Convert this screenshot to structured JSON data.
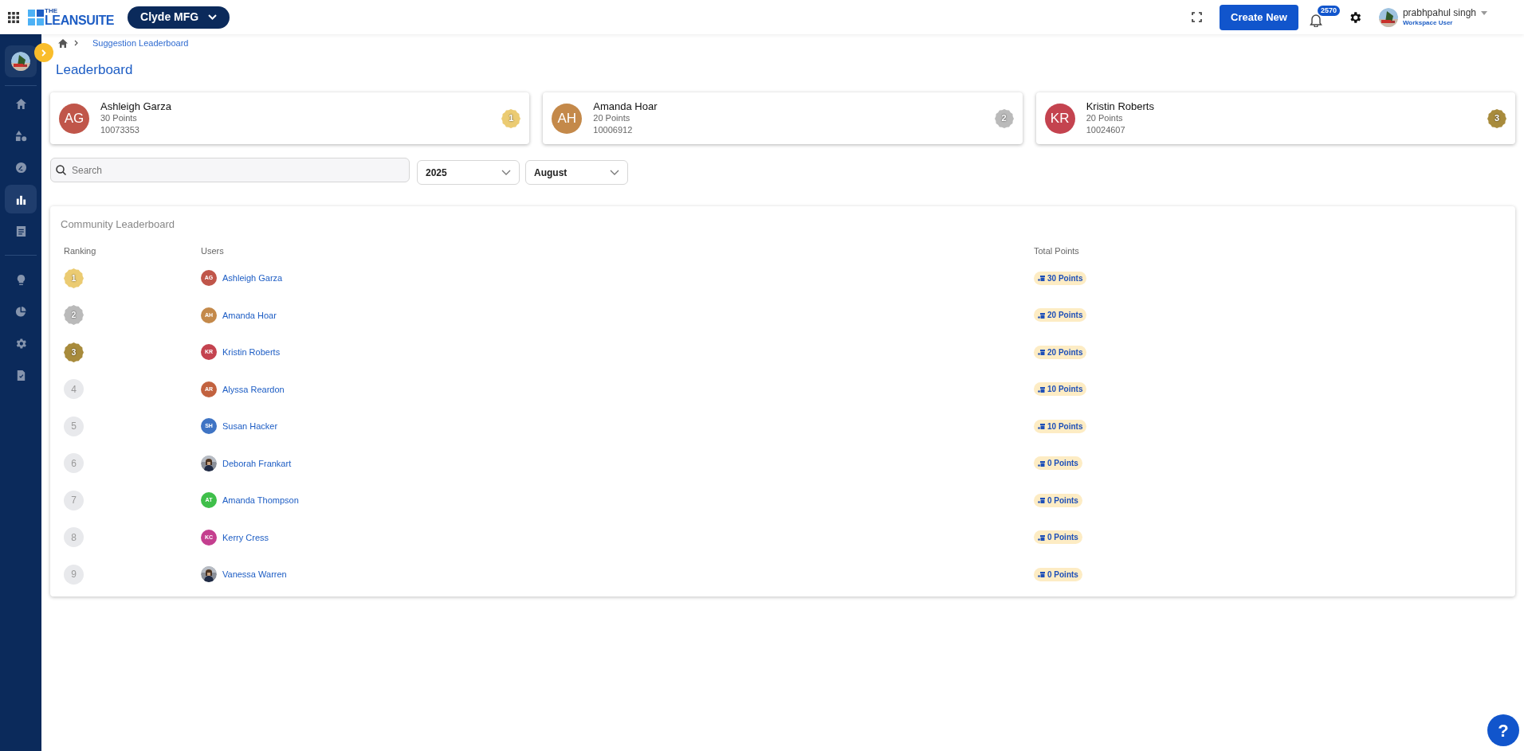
{
  "header": {
    "logo_small": "THE",
    "logo": "LEANSUITE",
    "org": "Clyde MFG",
    "create_button": "Create New",
    "notification_count": "2570",
    "user_name": "prabhpahul singh",
    "user_role": "Workspace User"
  },
  "sidebar": {
    "items": [
      {
        "selected": false
      },
      {
        "selected": false
      },
      {
        "selected": false
      },
      {
        "selected": true
      },
      {
        "selected": false
      },
      {
        "selected": false
      },
      {
        "selected": false
      },
      {
        "selected": false
      },
      {
        "selected": false
      }
    ]
  },
  "breadcrumb": [
    "Suggestion Leaderboard"
  ],
  "title": "Leaderboard",
  "podium": [
    {
      "avatar": {
        "initials": "AG",
        "color": "#c0564a"
      },
      "name": "Ashleigh Garza",
      "points": "30 Points",
      "id": "10073353",
      "rank": "1",
      "color": "#ebcb72"
    },
    {
      "avatar": {
        "initials": "AH",
        "color": "#c4894a"
      },
      "name": "Amanda Hoar",
      "points": "20 Points",
      "id": "10006912",
      "rank": "2",
      "color": "#bababa"
    },
    {
      "avatar": {
        "initials": "KR",
        "color": "#c4434f"
      },
      "name": "Kristin Roberts",
      "points": "20 Points",
      "id": "10024607",
      "rank": "3",
      "color": "#a88b3c"
    }
  ],
  "filters": {
    "search": {
      "placeholder": "Search"
    },
    "year": "2025",
    "month": "August"
  },
  "table": {
    "title": "Community Leaderboard",
    "columns": [
      "Ranking",
      "Users",
      "Total Points"
    ],
    "rows": [
      {
        "rank": "1",
        "kind": "medal",
        "color": "#ebcb72",
        "avatar": {
          "kind": "initials",
          "initials": "AG",
          "color": "#c0564a"
        },
        "name": "Ashleigh Garza",
        "points": "30 Points"
      },
      {
        "rank": "2",
        "kind": "medal",
        "color": "#bababa",
        "avatar": {
          "kind": "initials",
          "initials": "AH",
          "color": "#c4894a"
        },
        "name": "Amanda Hoar",
        "points": "20 Points"
      },
      {
        "rank": "3",
        "kind": "medal",
        "color": "#a88b3c",
        "avatar": {
          "kind": "initials",
          "initials": "KR",
          "color": "#c4434f"
        },
        "name": "Kristin Roberts",
        "points": "20 Points"
      },
      {
        "rank": "4",
        "kind": "plain",
        "avatar": {
          "kind": "initials",
          "initials": "AR",
          "color": "#c2623f"
        },
        "name": "Alyssa Reardon",
        "points": "10 Points"
      },
      {
        "rank": "5",
        "kind": "plain",
        "avatar": {
          "kind": "initials",
          "initials": "SH",
          "color": "#3f74c4"
        },
        "name": "Susan Hacker",
        "points": "10 Points"
      },
      {
        "rank": "6",
        "kind": "plain",
        "name": "Deborah Frankart",
        "points": "0 Points"
      },
      {
        "rank": "7",
        "kind": "plain",
        "avatar": {
          "kind": "initials",
          "initials": "AT",
          "color": "#3fbf4a"
        },
        "name": "Amanda Thompson",
        "points": "0 Points"
      },
      {
        "rank": "8",
        "kind": "plain",
        "avatar": {
          "kind": "initials",
          "initials": "KC",
          "color": "#c43f8f"
        },
        "name": "Kerry Cress",
        "points": "0 Points"
      },
      {
        "rank": "9",
        "kind": "plain",
        "name": "Vanessa Warren",
        "points": "0 Points"
      }
    ]
  },
  "help": "?"
}
